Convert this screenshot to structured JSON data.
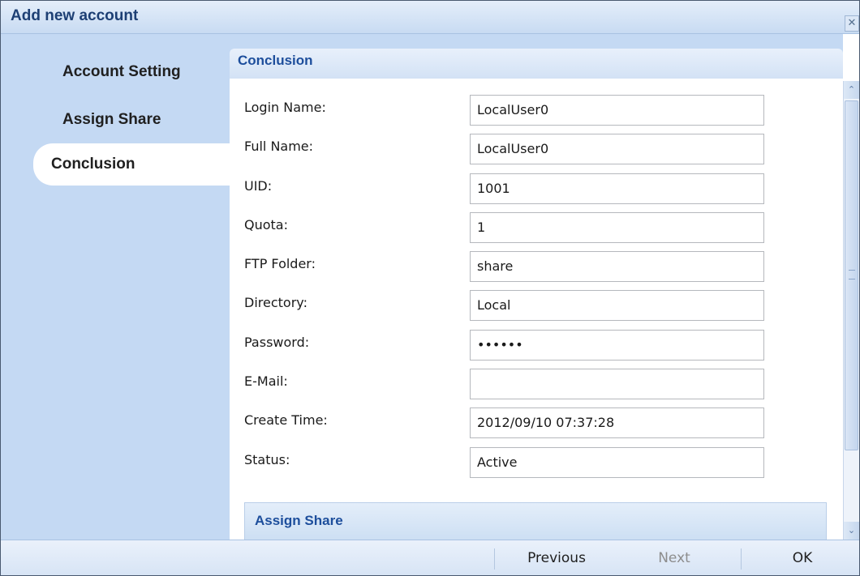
{
  "window": {
    "title": "Add new account",
    "close_glyph": "✕"
  },
  "sidebar": {
    "items": [
      {
        "label": "Account Setting",
        "active": false
      },
      {
        "label": "Assign Share",
        "active": false
      },
      {
        "label": "Conclusion",
        "active": true
      }
    ]
  },
  "main": {
    "section_title": "Conclusion",
    "fields": [
      {
        "label": "Login Name:",
        "value": "LocalUser0"
      },
      {
        "label": "Full Name:",
        "value": "LocalUser0"
      },
      {
        "label": "UID:",
        "value": "1001"
      },
      {
        "label": "Quota:",
        "value": "1"
      },
      {
        "label": "FTP Folder:",
        "value": "share"
      },
      {
        "label": "Directory:",
        "value": "Local"
      },
      {
        "label": "Password:",
        "value": "••••••"
      },
      {
        "label": "E-Mail:",
        "value": ""
      },
      {
        "label": "Create Time:",
        "value": "2012/09/10 07:37:28"
      },
      {
        "label": "Status:",
        "value": "Active"
      }
    ],
    "sub_section_title": "Assign Share",
    "scroll_up_glyph": "⌃",
    "scroll_down_glyph": "⌄"
  },
  "footer": {
    "previous_label": "Previous",
    "next_label": "Next",
    "ok_label": "OK"
  }
}
